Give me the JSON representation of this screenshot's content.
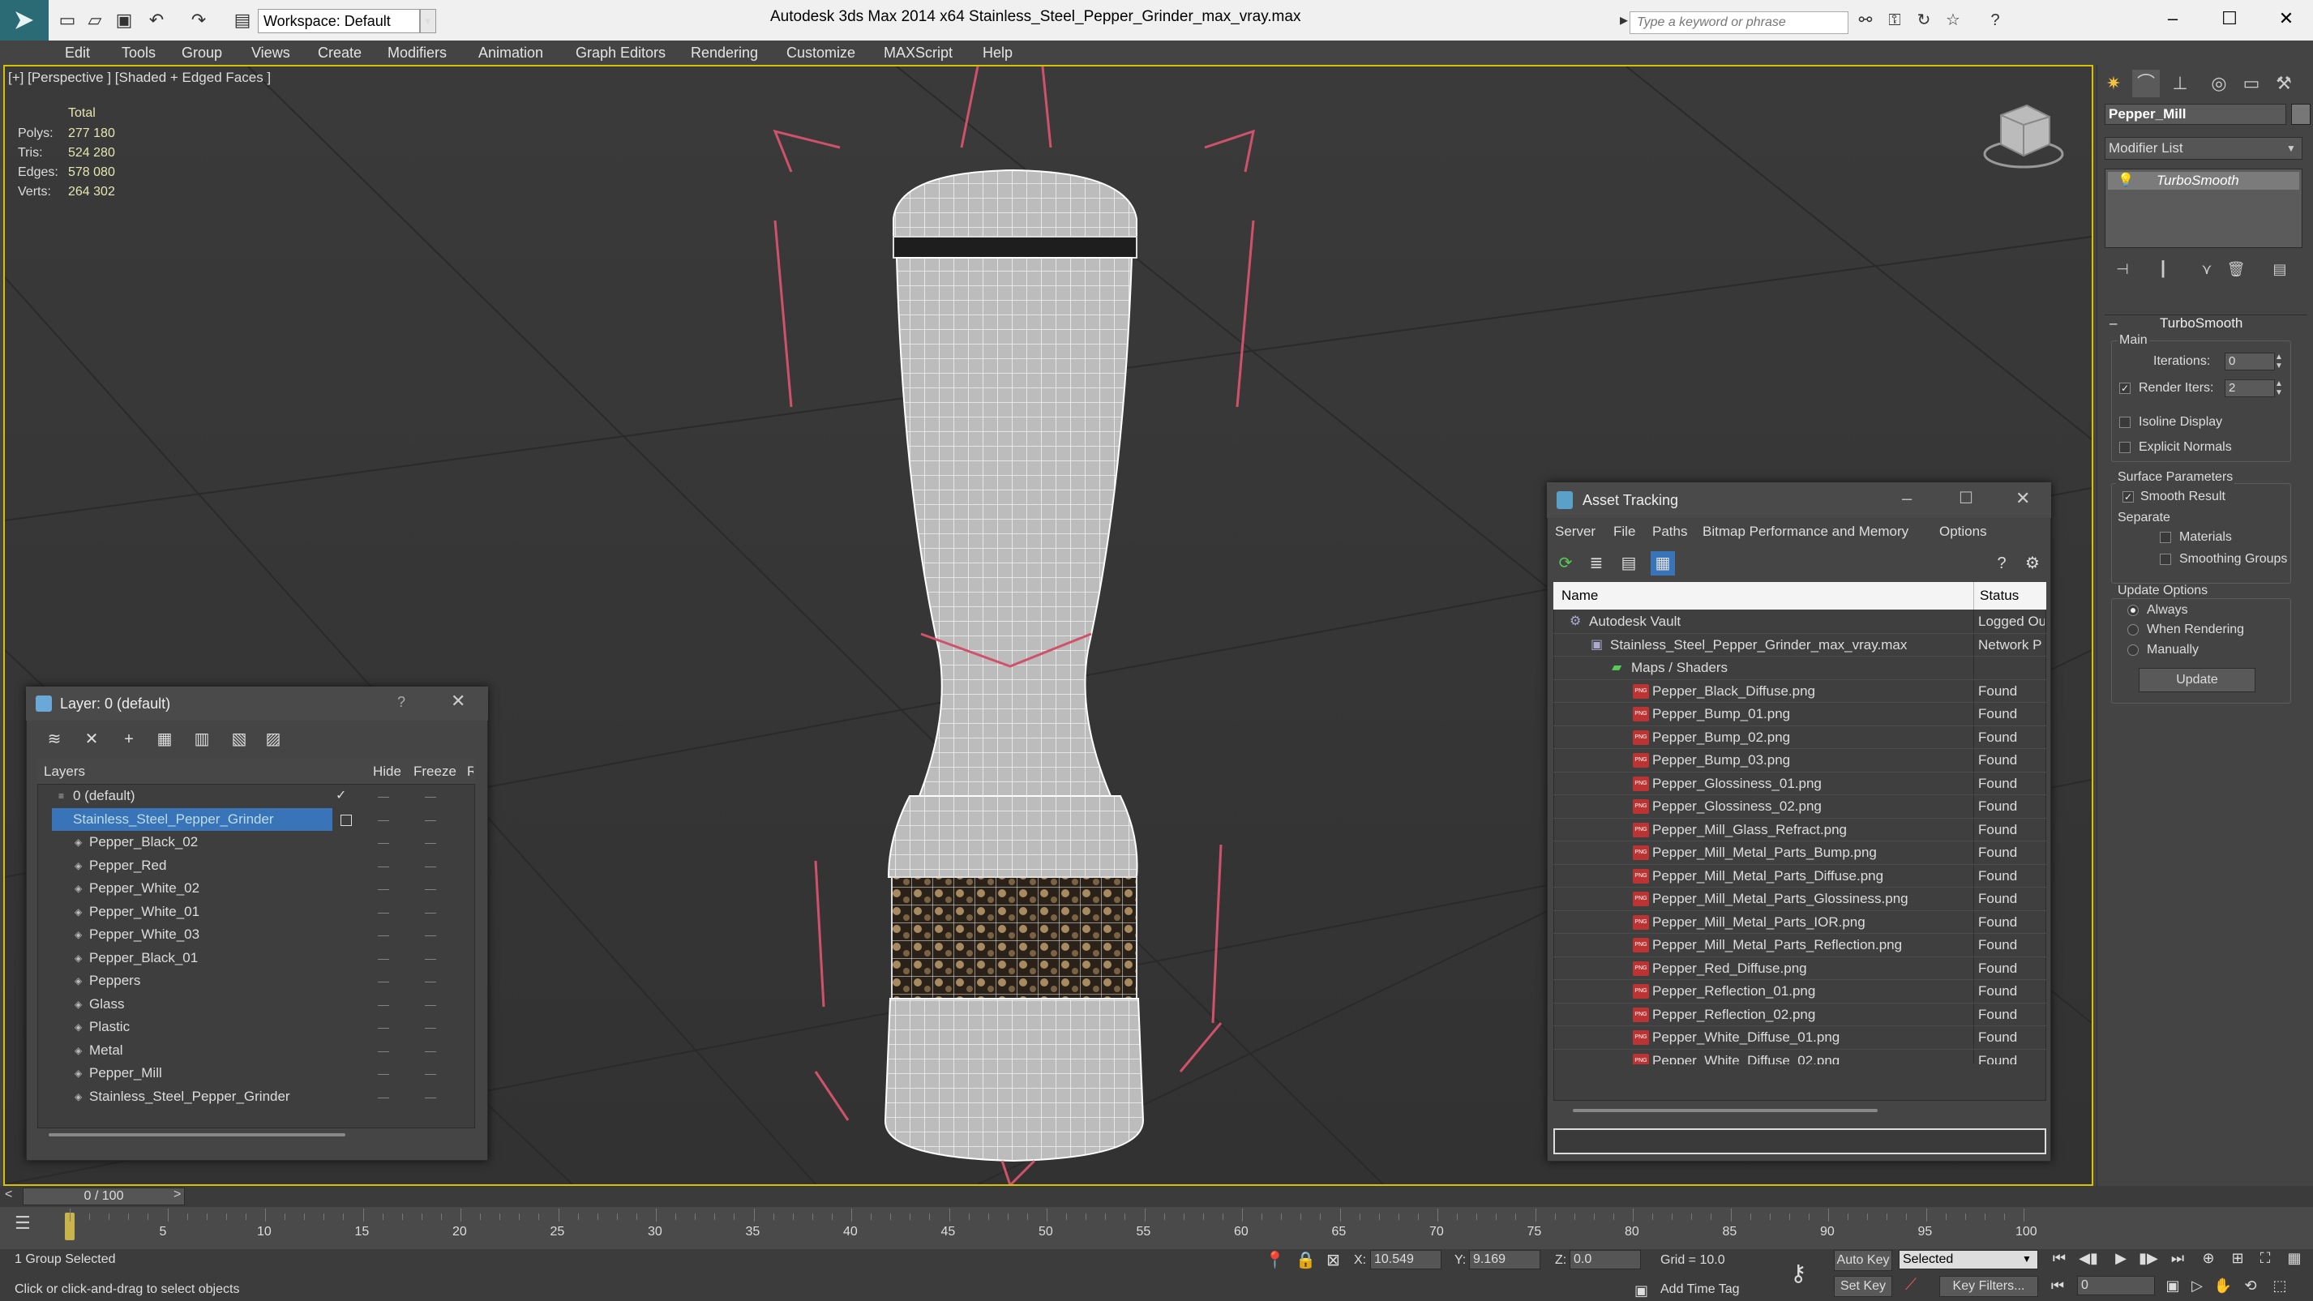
{
  "window": {
    "title": "Autodesk 3ds Max  2014 x64      Stainless_Steel_Pepper_Grinder_max_vray.max",
    "workspace": "Workspace: Default",
    "search_placeholder": "Type a keyword or phrase"
  },
  "menu": [
    "Edit",
    "Tools",
    "Group",
    "Views",
    "Create",
    "Modifiers",
    "Animation",
    "Graph Editors",
    "Rendering",
    "Customize",
    "MAXScript",
    "Help"
  ],
  "viewport": {
    "label": "[+] [Perspective ] [Shaded + Edged Faces ]",
    "stats": {
      "total": "Total",
      "rows": [
        {
          "label": "Polys:",
          "value": "277 180"
        },
        {
          "label": "Tris:",
          "value": "524 280"
        },
        {
          "label": "Edges:",
          "value": "578 080"
        },
        {
          "label": "Verts:",
          "value": "264 302"
        }
      ]
    }
  },
  "command_panel": {
    "object_name": "Pepper_Mill",
    "modifier_list": "Modifier List",
    "stack_item": "TurboSmooth",
    "rollout": "TurboSmooth",
    "main": {
      "group": "Main",
      "iterations_label": "Iterations:",
      "iterations": "0",
      "render_iters_label": "Render Iters:",
      "render_iters": "2",
      "isoline": "Isoline Display",
      "explicit": "Explicit Normals"
    },
    "surface": {
      "group": "Surface Parameters",
      "smooth": "Smooth Result",
      "separate": "Separate",
      "materials": "Materials",
      "smoothing": "Smoothing Groups"
    },
    "update": {
      "group": "Update Options",
      "always": "Always",
      "when_rendering": "When Rendering",
      "manually": "Manually",
      "button": "Update"
    }
  },
  "layer_dialog": {
    "title": "Layer: 0 (default)",
    "help": "?",
    "cols": {
      "layers": "Layers",
      "hide": "Hide",
      "freeze": "Freeze",
      "extra": "R"
    },
    "rows": [
      {
        "name": "0 (default)",
        "indent": 0
      },
      {
        "name": "Stainless_Steel_Pepper_Grinder",
        "indent": 0
      },
      {
        "name": "Pepper_Black_02",
        "indent": 1
      },
      {
        "name": "Pepper_Red",
        "indent": 1
      },
      {
        "name": "Pepper_White_02",
        "indent": 1
      },
      {
        "name": "Pepper_White_01",
        "indent": 1
      },
      {
        "name": "Pepper_White_03",
        "indent": 1
      },
      {
        "name": "Pepper_Black_01",
        "indent": 1
      },
      {
        "name": "Peppers",
        "indent": 1
      },
      {
        "name": "Glass",
        "indent": 1
      },
      {
        "name": "Plastic",
        "indent": 1
      },
      {
        "name": "Metal",
        "indent": 1
      },
      {
        "name": "Pepper_Mill",
        "indent": 1
      },
      {
        "name": "Stainless_Steel_Pepper_Grinder",
        "indent": 1
      }
    ]
  },
  "asset_dialog": {
    "title": "Asset Tracking",
    "menu": [
      "Server",
      "File",
      "Paths",
      "Bitmap Performance and Memory",
      "Options"
    ],
    "cols": {
      "name": "Name",
      "status": "Status"
    },
    "rows": [
      {
        "name": "Autodesk Vault",
        "status": "Logged Ou",
        "level": 0
      },
      {
        "name": "Stainless_Steel_Pepper_Grinder_max_vray.max",
        "status": "Network P",
        "level": 1
      },
      {
        "name": "Maps / Shaders",
        "status": "",
        "level": 2
      },
      {
        "name": "Pepper_Black_Diffuse.png",
        "status": "Found",
        "level": 3
      },
      {
        "name": "Pepper_Bump_01.png",
        "status": "Found",
        "level": 3
      },
      {
        "name": "Pepper_Bump_02.png",
        "status": "Found",
        "level": 3
      },
      {
        "name": "Pepper_Bump_03.png",
        "status": "Found",
        "level": 3
      },
      {
        "name": "Pepper_Glossiness_01.png",
        "status": "Found",
        "level": 3
      },
      {
        "name": "Pepper_Glossiness_02.png",
        "status": "Found",
        "level": 3
      },
      {
        "name": "Pepper_Mill_Glass_Refract.png",
        "status": "Found",
        "level": 3
      },
      {
        "name": "Pepper_Mill_Metal_Parts_Bump.png",
        "status": "Found",
        "level": 3
      },
      {
        "name": "Pepper_Mill_Metal_Parts_Diffuse.png",
        "status": "Found",
        "level": 3
      },
      {
        "name": "Pepper_Mill_Metal_Parts_Glossiness.png",
        "status": "Found",
        "level": 3
      },
      {
        "name": "Pepper_Mill_Metal_Parts_IOR.png",
        "status": "Found",
        "level": 3
      },
      {
        "name": "Pepper_Mill_Metal_Parts_Reflection.png",
        "status": "Found",
        "level": 3
      },
      {
        "name": "Pepper_Red_Diffuse.png",
        "status": "Found",
        "level": 3
      },
      {
        "name": "Pepper_Reflection_01.png",
        "status": "Found",
        "level": 3
      },
      {
        "name": "Pepper_Reflection_02.png",
        "status": "Found",
        "level": 3
      },
      {
        "name": "Pepper_White_Diffuse_01.png",
        "status": "Found",
        "level": 3
      },
      {
        "name": "Pepper_White_Diffuse_02.png",
        "status": "Found",
        "level": 3
      }
    ]
  },
  "timeline": {
    "frame": "0 / 100",
    "ticks": [
      "5",
      "10",
      "15",
      "20",
      "25",
      "30",
      "35",
      "40",
      "45",
      "50",
      "55",
      "60",
      "65",
      "70",
      "75",
      "80",
      "85",
      "90",
      "95",
      "100"
    ]
  },
  "status": {
    "selection": "1 Group Selected",
    "prompt": "Click or click-and-drag to select objects",
    "x_label": "X:",
    "x": "10.549",
    "y_label": "Y:",
    "y": "9.169",
    "z_label": "Z:",
    "z": "0.0",
    "grid": "Grid = 10.0",
    "auto_key": "Auto Key",
    "auto_key_mode": "Selected",
    "set_key": "Set Key",
    "key_filters": "Key Filters...",
    "add_time_tag": "Add Time Tag",
    "frame_field": "0"
  }
}
